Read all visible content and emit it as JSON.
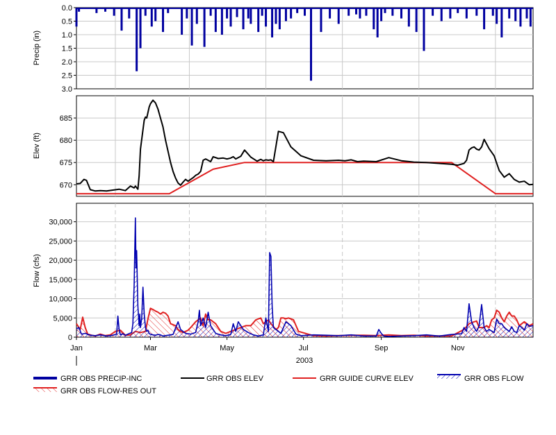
{
  "colors": {
    "precip": "#0000a0",
    "elev": "#000000",
    "guide": "#e02020",
    "flow": "#0000b0",
    "resout": "#e02020",
    "grid": "#c8c8c8",
    "frame": "#000000"
  },
  "chart_data": [
    {
      "type": "bar",
      "ylabel": "Precip (in)",
      "ylim": [
        3.0,
        0.0
      ],
      "y_inverted": true,
      "yticks": [
        "0.0",
        "0.5",
        "1.0",
        "1.5",
        "2.0",
        "2.5",
        "3.0"
      ],
      "ytick_values": [
        0,
        0.5,
        1.0,
        1.5,
        2.0,
        2.5,
        3.0
      ],
      "grid": true,
      "x_day_of_year": [
        1,
        3,
        17,
        24,
        31,
        37,
        43,
        49,
        52,
        56,
        61,
        64,
        70,
        74,
        85,
        89,
        93,
        97,
        103,
        108,
        112,
        117,
        121,
        124,
        129,
        134,
        138,
        140,
        146,
        149,
        152,
        157,
        160,
        163,
        168,
        172,
        177,
        183,
        188,
        196,
        203,
        210,
        218,
        224,
        227,
        232,
        238,
        241,
        244,
        247,
        253,
        260,
        266,
        272,
        278,
        285,
        292,
        299,
        305,
        312,
        320,
        326,
        333,
        336,
        340,
        346,
        351,
        355,
        360,
        363
      ],
      "series": [
        {
          "name": "GRR OBS PRECIP-INC",
          "values": [
            0.7,
            0.15,
            0.2,
            0.15,
            0.3,
            0.85,
            0.4,
            2.35,
            1.5,
            0.3,
            0.7,
            0.5,
            0.9,
            0.2,
            1.0,
            0.4,
            1.4,
            0.6,
            1.45,
            0.3,
            0.9,
            1.0,
            0.4,
            0.7,
            0.35,
            0.8,
            0.4,
            0.6,
            0.9,
            0.3,
            0.7,
            1.1,
            0.6,
            0.8,
            0.5,
            0.4,
            0.2,
            0.3,
            2.7,
            0.9,
            0.4,
            0.6,
            0.3,
            0.25,
            0.4,
            0.3,
            0.8,
            1.1,
            0.5,
            0.2,
            0.3,
            0.4,
            0.7,
            0.9,
            1.6,
            0.3,
            0.5,
            0.4,
            0.2,
            0.4,
            0.3,
            0.8,
            0.3,
            0.6,
            1.1,
            0.4,
            0.5,
            0.7,
            0.4,
            0.7
          ]
        }
      ]
    },
    {
      "type": "line",
      "ylabel": "Elev (ft)",
      "ylim": [
        667.4,
        690.0
      ],
      "yticks": [
        "670",
        "675",
        "680",
        "685"
      ],
      "ytick_values": [
        670,
        675,
        680,
        685
      ],
      "grid": true,
      "series": [
        {
          "name": "GRR OBS ELEV",
          "x_day_of_year": [
            1,
            4,
            7,
            9,
            12,
            16,
            20,
            25,
            30,
            35,
            40,
            44,
            47,
            48,
            50,
            51,
            52,
            55,
            56,
            57,
            59,
            60,
            62,
            64,
            66,
            68,
            70,
            72,
            74,
            76,
            78,
            80,
            82,
            84,
            86,
            88,
            90,
            92,
            94,
            96,
            98,
            100,
            102,
            104,
            108,
            110,
            114,
            118,
            121,
            124,
            126,
            128,
            132,
            135,
            140,
            145,
            148,
            150,
            152,
            154,
            156,
            158,
            162,
            166,
            172,
            180,
            190,
            200,
            210,
            215,
            220,
            225,
            230,
            240,
            250,
            260,
            270,
            280,
            290,
            300,
            305,
            310,
            312,
            314,
            316,
            318,
            320,
            322,
            324,
            326,
            330,
            334,
            338,
            342,
            346,
            350,
            354,
            358,
            362,
            365
          ],
          "values": [
            670.2,
            670.3,
            671.2,
            671.0,
            668.9,
            668.6,
            668.7,
            668.6,
            668.8,
            669.0,
            668.7,
            669.7,
            669.3,
            669.7,
            669.0,
            672.0,
            678.0,
            684.5,
            685.2,
            685.0,
            687.5,
            688.2,
            689.0,
            688.4,
            687.0,
            685.0,
            683.0,
            680.0,
            677.5,
            675.0,
            673.0,
            671.5,
            670.4,
            669.9,
            670.6,
            671.2,
            670.8,
            671.2,
            671.6,
            672.1,
            672.4,
            673.0,
            675.5,
            675.8,
            675.2,
            676.3,
            675.9,
            676.0,
            675.8,
            676.0,
            676.3,
            675.8,
            676.4,
            677.8,
            676.2,
            675.3,
            675.7,
            675.4,
            675.6,
            675.5,
            675.6,
            675.2,
            682.0,
            681.7,
            678.5,
            676.5,
            675.5,
            675.4,
            675.5,
            675.4,
            675.6,
            675.2,
            675.3,
            675.2,
            676.1,
            675.4,
            675.1,
            675.0,
            674.8,
            674.6,
            674.4,
            674.8,
            675.5,
            677.8,
            678.3,
            678.5,
            678.0,
            677.8,
            678.5,
            680.2,
            678.1,
            676.5,
            673.2,
            671.7,
            672.5,
            671.2,
            670.6,
            670.8,
            670.0,
            670.1
          ]
        },
        {
          "name": "GRR GUIDE CURVE ELEV",
          "x_day_of_year": [
            1,
            75,
            110,
            135,
            300,
            335,
            365
          ],
          "values": [
            668.0,
            668.0,
            673.5,
            675.0,
            675.0,
            668.0,
            668.0
          ]
        }
      ]
    },
    {
      "type": "area",
      "ylabel": "Flow (cfs)",
      "ylim": [
        0,
        34800
      ],
      "yticks": [
        "0",
        "5,000",
        "10,000",
        "15,000",
        "20,000",
        "25,000",
        "30,000"
      ],
      "ytick_values": [
        0,
        5000,
        10000,
        15000,
        20000,
        25000,
        30000
      ],
      "grid": true,
      "xticks": [
        "Jan",
        "Mar",
        "May",
        "Jul",
        "Sep",
        "Nov"
      ],
      "xtick_days": [
        1,
        60,
        121,
        182,
        244,
        305
      ],
      "xlabel": "2003",
      "month_days": [
        32,
        91,
        152,
        213,
        274,
        335
      ],
      "series": [
        {
          "name": "GRR OBS FLOW",
          "x_day_of_year": [
            1,
            3,
            5,
            8,
            12,
            16,
            20,
            25,
            30,
            33,
            34,
            35,
            36,
            38,
            40,
            42,
            45,
            46,
            47,
            48,
            48.5,
            49,
            50,
            51,
            51.5,
            52,
            53,
            54,
            55,
            56,
            57,
            58,
            59,
            60,
            62,
            64,
            66,
            68,
            70,
            74,
            78,
            82,
            84,
            86,
            88,
            92,
            96,
            98,
            99,
            100,
            102,
            104,
            106,
            108,
            110,
            112,
            116,
            120,
            124,
            126,
            128,
            130,
            134,
            138,
            142,
            146,
            150,
            152,
            154,
            155,
            156,
            157,
            158,
            160,
            164,
            168,
            172,
            176,
            180,
            190,
            200,
            210,
            220,
            230,
            240,
            242,
            244,
            246,
            250,
            260,
            270,
            280,
            290,
            300,
            308,
            310,
            312,
            314,
            316,
            318,
            320,
            322,
            324,
            326,
            328,
            330,
            334,
            336,
            338,
            340,
            342,
            344,
            346,
            348,
            350,
            352,
            354,
            356,
            358,
            360,
            362,
            365
          ],
          "values": [
            2200,
            2500,
            800,
            1000,
            500,
            400,
            600,
            300,
            500,
            800,
            5500,
            2000,
            600,
            900,
            500,
            800,
            1200,
            3500,
            13500,
            31000,
            18000,
            22500,
            8000,
            3000,
            6000,
            2500,
            5000,
            13000,
            6000,
            2500,
            1500,
            1800,
            900,
            800,
            600,
            500,
            700,
            600,
            300,
            500,
            700,
            4000,
            2000,
            1500,
            1000,
            800,
            1200,
            4000,
            7000,
            3000,
            5000,
            2500,
            6500,
            3000,
            2000,
            1000,
            600,
            400,
            700,
            3500,
            1500,
            4000,
            2000,
            1200,
            600,
            300,
            600,
            5000,
            1500,
            22000,
            21000,
            8000,
            2500,
            2000,
            1000,
            4000,
            3000,
            800,
            400,
            600,
            500,
            400,
            600,
            300,
            300,
            2000,
            1000,
            300,
            200,
            300,
            400,
            600,
            300,
            700,
            900,
            2500,
            1500,
            8700,
            4000,
            2500,
            1500,
            3000,
            8500,
            2500,
            1500,
            2000,
            1200,
            4700,
            3500,
            3500,
            2500,
            2000,
            1500,
            2700,
            1500,
            1200,
            3000,
            2500,
            1800,
            3500,
            2800,
            3000
          ]
        },
        {
          "name": "GRR OBS FLOW-RES OUT",
          "x_day_of_year": [
            1,
            4,
            6,
            8,
            10,
            13,
            16,
            20,
            24,
            28,
            32,
            36,
            40,
            44,
            48,
            52,
            56,
            58,
            60,
            62,
            64,
            66,
            68,
            70,
            72,
            74,
            76,
            80,
            82,
            84,
            86,
            88,
            90,
            92,
            96,
            100,
            102,
            104,
            106,
            108,
            110,
            112,
            116,
            120,
            124,
            128,
            132,
            136,
            140,
            144,
            148,
            150,
            152,
            154,
            156,
            160,
            162,
            164,
            166,
            168,
            170,
            174,
            178,
            190,
            200,
            210,
            220,
            230,
            240,
            250,
            260,
            270,
            280,
            290,
            300,
            310,
            314,
            318,
            320,
            322,
            326,
            328,
            330,
            332,
            334,
            336,
            338,
            340,
            342,
            344,
            346,
            348,
            350,
            352,
            354,
            356,
            358,
            362,
            365
          ],
          "values": [
            3500,
            2000,
            5200,
            2500,
            800,
            500,
            300,
            800,
            400,
            600,
            1500,
            1800,
            500,
            600,
            1500,
            1200,
            1500,
            4800,
            7500,
            7200,
            6800,
            6500,
            6000,
            6500,
            6200,
            5500,
            3500,
            3000,
            2000,
            1500,
            1200,
            1500,
            1800,
            2500,
            4000,
            5000,
            3000,
            6000,
            4500,
            4500,
            4000,
            3500,
            1500,
            1000,
            1500,
            2000,
            2500,
            3000,
            3000,
            4500,
            5000,
            3500,
            4000,
            4500,
            3500,
            2000,
            2500,
            5000,
            5000,
            4800,
            5000,
            4500,
            1500,
            400,
            300,
            400,
            500,
            500,
            400,
            600,
            400,
            500,
            300,
            300,
            300,
            2000,
            3500,
            4000,
            4200,
            2500,
            2500,
            3000,
            2500,
            4500,
            5000,
            7000,
            6500,
            5000,
            4000,
            5500,
            6500,
            5500,
            5500,
            4500,
            3000,
            3500,
            4000,
            3000,
            3500
          ]
        }
      ]
    }
  ],
  "legend": {
    "items": [
      {
        "label": "GRR OBS PRECIP-INC",
        "style": "thick-line",
        "color": "#0000a0"
      },
      {
        "label": "GRR OBS ELEV",
        "style": "line",
        "color": "#000000"
      },
      {
        "label": "GRR GUIDE CURVE ELEV",
        "style": "line",
        "color": "#e02020"
      },
      {
        "label": "GRR OBS FLOW",
        "style": "hatch",
        "color": "#0000b0"
      },
      {
        "label": "GRR OBS FLOW-RES OUT",
        "style": "hatch",
        "color": "#e02020"
      }
    ]
  }
}
